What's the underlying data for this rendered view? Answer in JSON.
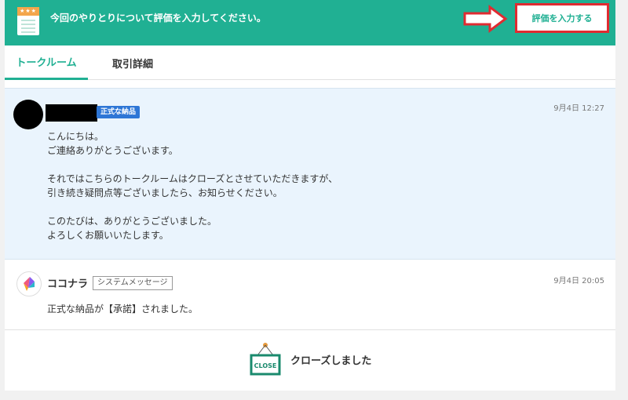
{
  "banner": {
    "icon": "evaluation-sheet-icon",
    "message": "今回のやりとりについて評価を入力してください。",
    "eval_button": "評価を入力する",
    "arrow_color": "#e02b31",
    "bg_color": "#20b093"
  },
  "tabs": [
    {
      "label": "トークルーム",
      "active": true
    },
    {
      "label": "取引詳細",
      "active": false
    }
  ],
  "messages": [
    {
      "badge": "正式な納品",
      "time": "9月4日 12:27",
      "lines": [
        "こんにちは。",
        "ご連絡ありがとうございます。",
        "",
        "それではこちらのトークルームはクローズとさせていただきますが、",
        "引き続き疑問点等ございましたら、お知らせください。",
        "",
        "このたびは、ありがとうございました。",
        "よろしくお願いいたします。"
      ]
    },
    {
      "sender": "ココナラ",
      "badge": "システムメッセージ",
      "time": "9月4日 20:05",
      "text": "正式な納品が【承諾】されました。"
    }
  ],
  "close": {
    "sign_label": "CLOSE",
    "text": "クローズしました"
  }
}
